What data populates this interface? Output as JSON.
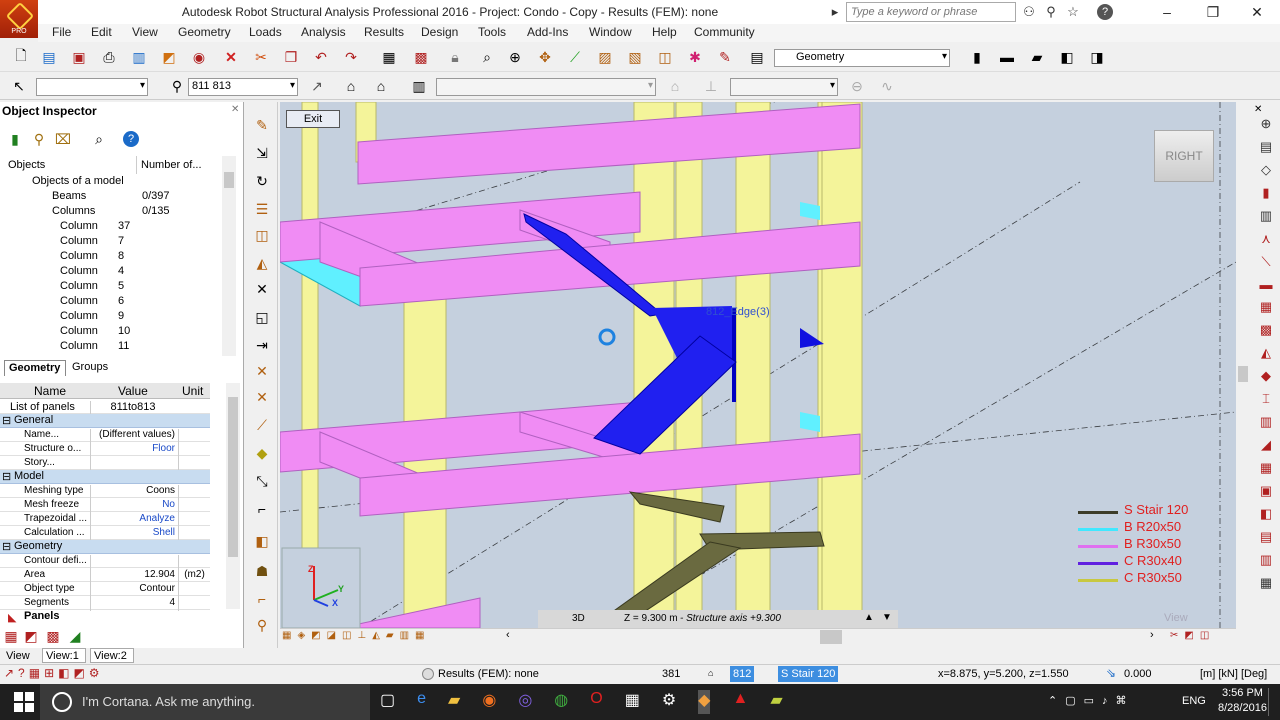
{
  "app": {
    "title": "Autodesk Robot Structural Analysis Professional 2016 - Project: Condo - Copy - Results (FEM): none",
    "logo_label": "PRO",
    "search_placeholder": "Type a keyword or phrase"
  },
  "menu": [
    "File",
    "Edit",
    "View",
    "Geometry",
    "Loads",
    "Analysis",
    "Results",
    "Design",
    "Tools",
    "Add-Ins",
    "Window",
    "Help",
    "Community"
  ],
  "toolbar": {
    "layout_combo": "Geometry",
    "selection_input": "811 813"
  },
  "inspector": {
    "title": "Object Inspector",
    "col_objects": "Objects",
    "col_number": "Number of...",
    "tree": [
      {
        "label": "Objects of a model",
        "count": ""
      },
      {
        "label": "Beams",
        "count": "0/397"
      },
      {
        "label": "Columns",
        "count": "0/135"
      },
      {
        "label": "Column",
        "count": "37"
      },
      {
        "label": "Column",
        "count": "7"
      },
      {
        "label": "Column",
        "count": "8"
      },
      {
        "label": "Column",
        "count": "4"
      },
      {
        "label": "Column",
        "count": "5"
      },
      {
        "label": "Column",
        "count": "6"
      },
      {
        "label": "Column",
        "count": "9"
      },
      {
        "label": "Column",
        "count": "10"
      },
      {
        "label": "Column",
        "count": "11"
      }
    ],
    "tabs": [
      "Geometry",
      "Groups"
    ],
    "prop_headers": [
      "Name",
      "Value",
      "Unit"
    ],
    "list_label": "List of panels",
    "list_value": "811to813",
    "groups": {
      "general": "General",
      "model": "Model",
      "geometry": "Geometry"
    },
    "general_rows": [
      {
        "name": "Name...",
        "value": "(Different values)",
        "unit": ""
      },
      {
        "name": "Structure o...",
        "value": "Floor",
        "unit": ""
      },
      {
        "name": "Story...",
        "value": "",
        "unit": ""
      }
    ],
    "model_rows": [
      {
        "name": "Meshing type",
        "value": "Coons",
        "unit": ""
      },
      {
        "name": "Mesh freeze",
        "value": "No",
        "unit": ""
      },
      {
        "name": "Trapezoidal ...",
        "value": "Analyze",
        "unit": ""
      },
      {
        "name": "Calculation ...",
        "value": "Shell",
        "unit": ""
      }
    ],
    "geometry_rows": [
      {
        "name": "Contour defi...",
        "value": "",
        "unit": ""
      },
      {
        "name": "Area",
        "value": "12.904",
        "unit": "(m2)"
      },
      {
        "name": "Object type",
        "value": "Contour",
        "unit": ""
      },
      {
        "name": "Segments",
        "value": "4",
        "unit": ""
      }
    ],
    "panel_tab": "Panels"
  },
  "viewport": {
    "exit_label": "Exit",
    "cube_label": "RIGHT",
    "edge_label": "812_Edge(3)",
    "view_mode": "3D",
    "z_label": "Z = 9.300 m",
    "z_axis": "- Structure axis +9.300",
    "view_word": "View",
    "legend": [
      {
        "label": "S Stair 120",
        "color": "#3c3c28"
      },
      {
        "label": "B R20x50",
        "color": "#40e8ff"
      },
      {
        "label": "B R30x50",
        "color": "#e070f0"
      },
      {
        "label": "C R30x40",
        "color": "#6020e0"
      },
      {
        "label": "C R30x50",
        "color": "#c8c840"
      }
    ]
  },
  "view_tabs": [
    "View",
    "View:1",
    "View:2"
  ],
  "status": {
    "results": "Results (FEM): none",
    "node_count": "381",
    "panel_id": "812",
    "section": "S Stair 120",
    "coords": "x=8.875, y=5.200, z=1.550",
    "angle": "0.000",
    "units": "[m] [kN] [Deg]"
  },
  "taskbar": {
    "cortana": "I'm Cortana. Ask me anything.",
    "lang": "ENG",
    "time": "3:56 PM",
    "date": "8/28/2016"
  }
}
